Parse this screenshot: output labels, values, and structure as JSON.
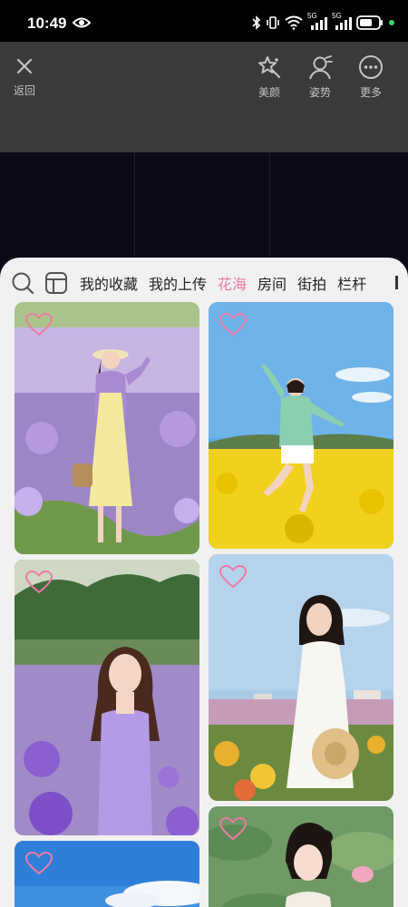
{
  "status_bar": {
    "time": "10:49",
    "network_1": "5G",
    "network_2": "5G"
  },
  "toolbar": {
    "back_label": "返回",
    "beauty_label": "美颜",
    "pose_label": "姿势",
    "more_label": "更多"
  },
  "categories": {
    "items": [
      "我的收藏",
      "我的上传",
      "花海",
      "房间",
      "街拍",
      "栏杆"
    ],
    "active": "花海"
  },
  "colors": {
    "accent": "#e87ca4",
    "sheet_bg": "#f1f1f1",
    "toolbar_bg": "#3a3a3a"
  },
  "icons": [
    "close-icon",
    "beauty-icon",
    "pose-icon",
    "more-icon",
    "search-icon",
    "layout-icon",
    "heart-icon"
  ]
}
